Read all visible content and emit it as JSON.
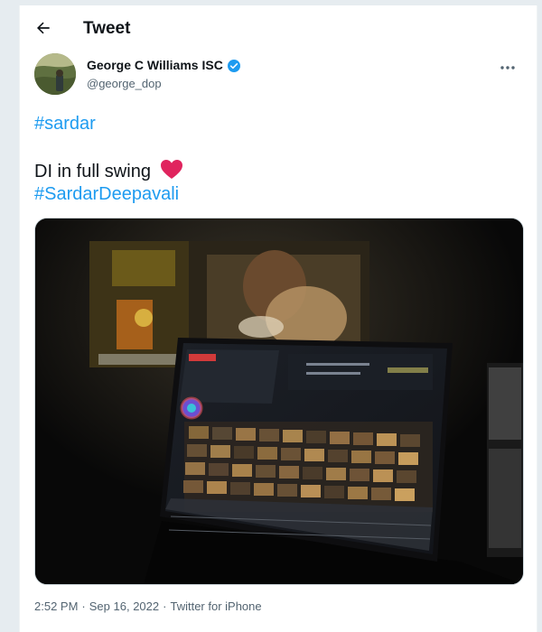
{
  "header": {
    "title": "Tweet"
  },
  "author": {
    "name": "George C Williams ISC",
    "handle": "@george_dop",
    "verified": true
  },
  "tweet": {
    "hashtag1": "#sardar",
    "line2_text": "DI  in full swing",
    "hashtag2": "#SardarDeepavali"
  },
  "meta": {
    "time": "2:52 PM",
    "sep1": "·",
    "date": "Sep 16, 2022",
    "sep2": "·",
    "source": "Twitter for iPhone"
  },
  "colors": {
    "accent": "#1d9bf0",
    "heart": "#e0245e",
    "secondary_text": "#536471"
  },
  "icons": [
    "back-arrow-icon",
    "verified-badge-icon",
    "more-icon",
    "heart-icon"
  ]
}
